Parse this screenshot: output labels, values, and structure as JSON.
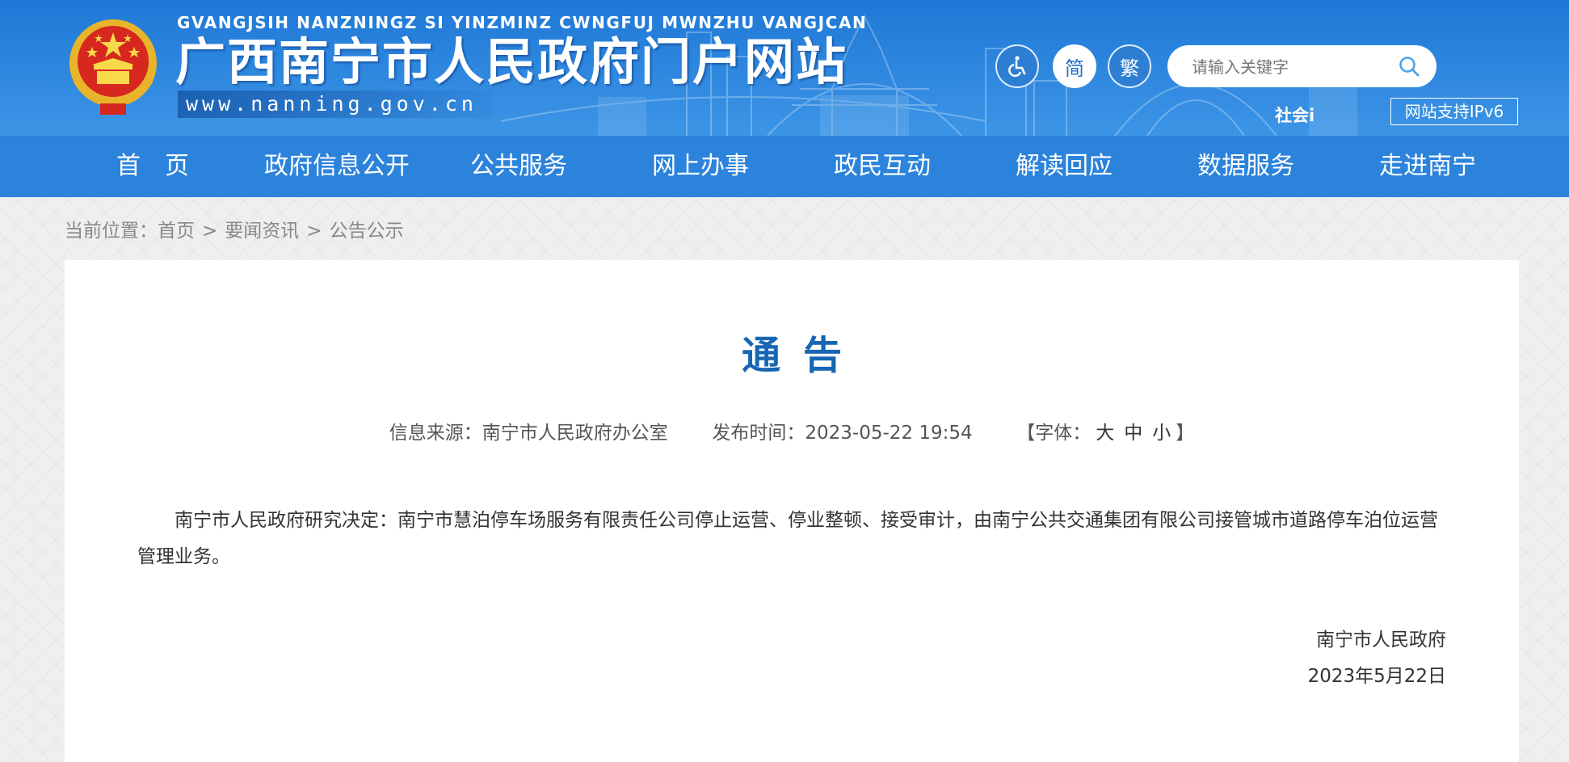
{
  "header": {
    "pinyin": "GVANGJSIH NANZNINGZ SI YINZMINZ CWNGFUJ MWNZHU VANGJCAN",
    "title": "广西南宁市人民政府门户网站",
    "url": "www.nanning.gov.cn",
    "accessibility_icon": "wheelchair-icon",
    "lang_simplified": "简",
    "lang_traditional": "繁",
    "search_placeholder": "请输入关键字",
    "search_icon": "search-icon",
    "marquee_text": "社会i",
    "ipv6_badge": "网站支持IPv6",
    "colors": {
      "header_blue": "#1e78d6",
      "nav_blue": "#2c83db",
      "title_blue": "#1766b3"
    }
  },
  "nav": {
    "items": [
      {
        "label": "首　页"
      },
      {
        "label": "政府信息公开"
      },
      {
        "label": "公共服务"
      },
      {
        "label": "网上办事"
      },
      {
        "label": "政民互动"
      },
      {
        "label": "解读回应"
      },
      {
        "label": "数据服务"
      },
      {
        "label": "走进南宁"
      }
    ]
  },
  "breadcrumb": {
    "prefix": "当前位置：",
    "items": [
      "首页",
      "要闻资讯",
      "公告公示"
    ],
    "separator": ">"
  },
  "article": {
    "title": "通告",
    "source_label": "信息来源：",
    "source": "南宁市人民政府办公室",
    "date_label": "发布时间：",
    "date": "2023-05-22 19:54",
    "font_label_open": "【字体：",
    "font_large": "大",
    "font_medium": "中",
    "font_small": "小",
    "font_label_close": "】",
    "body": "南宁市人民政府研究决定：南宁市慧泊停车场服务有限责任公司停止运营、停业整顿、接受审计，由南宁公共交通集团有限公司接管城市道路停车泊位运营管理业务。",
    "signature_org": "南宁市人民政府",
    "signature_date": "2023年5月22日"
  }
}
